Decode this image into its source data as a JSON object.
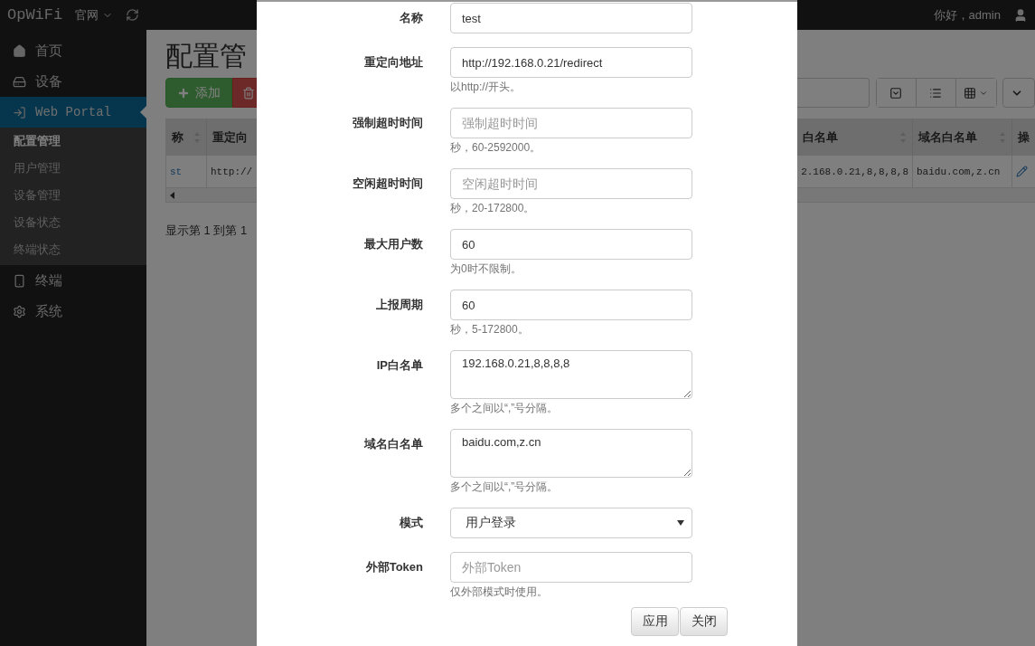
{
  "navbar": {
    "brand": "OpWiFi",
    "menu": "官网",
    "greeting": "你好，admin"
  },
  "sidebar": {
    "items": [
      {
        "label": "首页",
        "kind": "home",
        "selected": false
      },
      {
        "label": "设备",
        "kind": "device",
        "selected": false
      },
      {
        "label": "Web Portal",
        "kind": "portal",
        "selected": true,
        "children": [
          {
            "label": "配置管理",
            "selected": true
          },
          {
            "label": "用户管理",
            "selected": false
          },
          {
            "label": "设备管理",
            "selected": false
          },
          {
            "label": "设备状态",
            "selected": false
          },
          {
            "label": "终端状态",
            "selected": false
          }
        ]
      },
      {
        "label": "终端",
        "kind": "phone",
        "selected": false
      },
      {
        "label": "系统",
        "kind": "gear",
        "selected": false
      }
    ]
  },
  "page": {
    "title": "配置管",
    "add_button": "添加",
    "table": {
      "columns": [
        {
          "label": "称"
        },
        {
          "label": "重定向"
        },
        {
          "label": "白名单"
        },
        {
          "label": "域名白名单"
        },
        {
          "label": "操"
        }
      ],
      "rows": [
        {
          "cells": [
            "st",
            "http://",
            "2.168.0.21,8,8,8,8",
            "baidu.com,z.cn"
          ]
        }
      ]
    },
    "footer": "显示第 1 到第 1"
  },
  "modal": {
    "fields": [
      {
        "kind": "input",
        "label": "名称",
        "value": "test"
      },
      {
        "kind": "input",
        "label": "重定向地址",
        "value": "http://192.168.0.21/redirect",
        "help": "以http://开头。"
      },
      {
        "kind": "input",
        "label": "强制超时时间",
        "placeholder": "强制超时时间",
        "help": "秒，60-2592000。"
      },
      {
        "kind": "input",
        "label": "空闲超时时间",
        "placeholder": "空闲超时时间",
        "help": "秒，20-172800。"
      },
      {
        "kind": "input",
        "label": "最大用户数",
        "value": "60",
        "help": "为0时不限制。"
      },
      {
        "kind": "input",
        "label": "上报周期",
        "value": "60",
        "help": "秒，5-172800。"
      },
      {
        "kind": "textarea",
        "label": "IP白名单",
        "value": "192.168.0.21,8,8,8,8",
        "help": "多个之间以“,”号分隔。"
      },
      {
        "kind": "textarea",
        "label": "域名白名单",
        "value": "baidu.com,z.cn",
        "help": "多个之间以“,”号分隔。"
      },
      {
        "kind": "select",
        "label": "模式",
        "value": "用户登录"
      },
      {
        "kind": "input",
        "label": "外部Token",
        "placeholder": "外部Token",
        "help": "仅外部模式时使用。"
      }
    ],
    "buttons": [
      "应用",
      "关闭"
    ]
  }
}
